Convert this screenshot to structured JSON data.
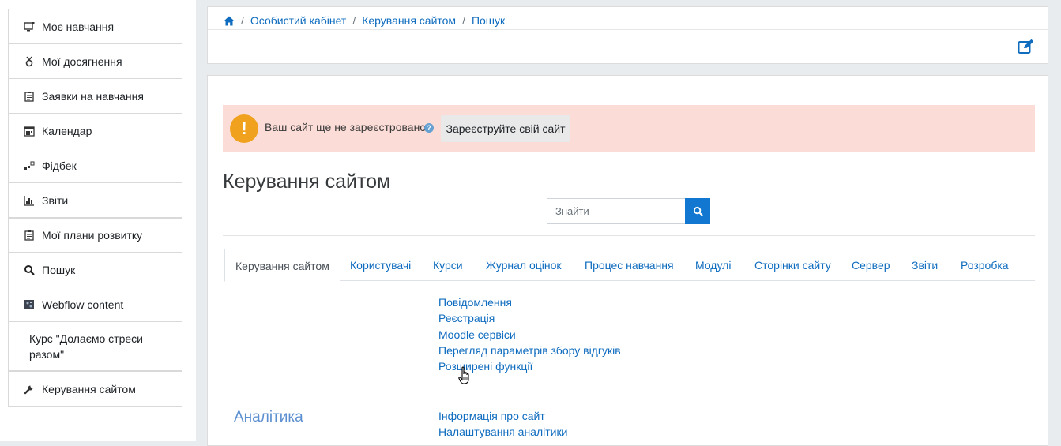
{
  "nav": {
    "items": [
      {
        "label": "Моє навчання",
        "icon": "screen-icon"
      },
      {
        "label": "Мої досягнення",
        "icon": "medal-icon"
      },
      {
        "label": "Заявки на навчання",
        "icon": "clipboard-icon"
      },
      {
        "label": "Календар",
        "icon": "calendar-icon"
      },
      {
        "label": "Фідбек",
        "icon": "feedback-icon"
      },
      {
        "label": "Звіти",
        "icon": "chart-icon"
      },
      {
        "label": "Мої плани розвитку",
        "icon": "clipboard-icon"
      },
      {
        "label": "Пошук",
        "icon": "search-icon"
      },
      {
        "label": "Webflow content",
        "icon": "webflow-icon"
      },
      {
        "label": "Курс \"Долаємо стреси разом\"",
        "icon": ""
      },
      {
        "label": "Керування сайтом",
        "icon": "wrench-icon"
      }
    ]
  },
  "breadcrumb": {
    "items": [
      "Особистий кабінет",
      "Керування сайтом",
      "Пошук"
    ]
  },
  "alert": {
    "text": "Ваш сайт ще не зареєстровано",
    "button": "Зареєструйте свій сайт",
    "color": "#fcdcd6"
  },
  "page": {
    "title": "Керування сайтом"
  },
  "search": {
    "placeholder": "Знайти"
  },
  "tabs": [
    "Керування сайтом",
    "Користувачі",
    "Курси",
    "Журнал оцінок",
    "Процес навчання",
    "Модулі",
    "Сторінки сайту",
    "Сервер",
    "Звіти",
    "Розробка"
  ],
  "links": [
    "Повідомлення",
    "Реєстрація",
    "Moodle сервіси",
    "Перегляд параметрів збору відгуків",
    "Розширені функції"
  ],
  "analytics": {
    "title": "Аналітика",
    "links": [
      "Інформація про сайт",
      "Налаштування аналітики"
    ]
  },
  "colors": {
    "link": "#0f6cbf",
    "accent": "#1177d1",
    "warning": "#f0a21e"
  }
}
